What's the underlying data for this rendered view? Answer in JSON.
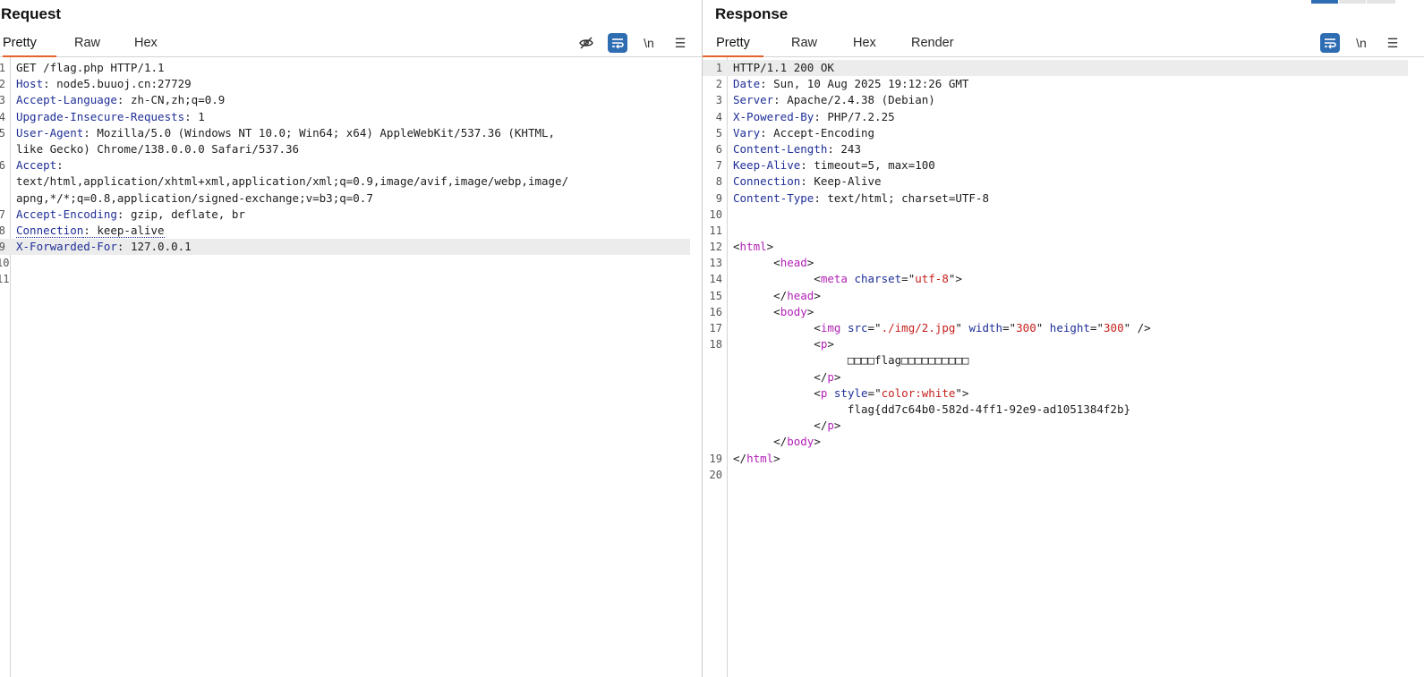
{
  "request": {
    "title": "Request",
    "tabs": [
      "Pretty",
      "Raw",
      "Hex"
    ],
    "active_tab": "Pretty",
    "tools": {
      "hide": "eye-off",
      "wrap": "word-wrap",
      "newline": "\\n",
      "menu": "☰"
    },
    "lines": [
      {
        "n": "1",
        "rows": [
          [
            {
              "s": "GET /flag.php HTTP/1.1"
            }
          ]
        ]
      },
      {
        "n": "2",
        "rows": [
          [
            {
              "s": "Host",
              "c": "k"
            },
            {
              "s": ": node5.buuoj.cn:27729"
            }
          ]
        ]
      },
      {
        "n": "3",
        "rows": [
          [
            {
              "s": "Accept-Language",
              "c": "k"
            },
            {
              "s": ": zh-CN,zh;q=0.9"
            }
          ]
        ]
      },
      {
        "n": "4",
        "rows": [
          [
            {
              "s": "Upgrade-Insecure-Requests",
              "c": "k"
            },
            {
              "s": ": 1"
            }
          ]
        ]
      },
      {
        "n": "5",
        "rows": [
          [
            {
              "s": "User-Agent",
              "c": "k"
            },
            {
              "s": ": Mozilla/5.0 (Windows NT 10.0; Win64; x64) AppleWebKit/537.36 (KHTML,"
            }
          ],
          [
            {
              "s": "like Gecko) Chrome/138.0.0.0 Safari/537.36"
            }
          ]
        ]
      },
      {
        "n": "6",
        "rows": [
          [
            {
              "s": "Accept",
              "c": "k"
            },
            {
              "s": ":"
            }
          ],
          [
            {
              "s": "text/html,application/xhtml+xml,application/xml;q=0.9,image/avif,image/webp,image/"
            }
          ],
          [
            {
              "s": "apng,*/*;q=0.8,application/signed-exchange;v=b3;q=0.7"
            }
          ]
        ]
      },
      {
        "n": "7",
        "rows": [
          [
            {
              "s": "Accept-Encoding",
              "c": "k"
            },
            {
              "s": ": gzip, deflate, br"
            }
          ]
        ]
      },
      {
        "n": "8",
        "rows": [
          [
            {
              "s": "Connection",
              "c": "k dotted"
            },
            {
              "s": ": keep-alive",
              "c": "dotted"
            }
          ]
        ]
      },
      {
        "n": "9",
        "hl": true,
        "rows": [
          [
            {
              "s": "X-Forwarded-For",
              "c": "k"
            },
            {
              "s": ": 127.0.0.1"
            }
          ]
        ]
      },
      {
        "n": "10",
        "rows": [
          []
        ]
      },
      {
        "n": "11",
        "rows": [
          []
        ]
      }
    ]
  },
  "response": {
    "title": "Response",
    "tabs": [
      "Pretty",
      "Raw",
      "Hex",
      "Render"
    ],
    "active_tab": "Pretty",
    "tools": {
      "wrap": "word-wrap",
      "newline": "\\n",
      "menu": "☰"
    },
    "lines": [
      {
        "n": "1",
        "hl": true,
        "rows": [
          [
            {
              "s": "HTTP/1.1 200 OK"
            }
          ]
        ]
      },
      {
        "n": "2",
        "rows": [
          [
            {
              "s": "Date",
              "c": "k"
            },
            {
              "s": ": Sun, 10 Aug 2025 19:12:26 GMT"
            }
          ]
        ]
      },
      {
        "n": "3",
        "rows": [
          [
            {
              "s": "Server",
              "c": "k"
            },
            {
              "s": ": Apache/2.4.38 (Debian)"
            }
          ]
        ]
      },
      {
        "n": "4",
        "rows": [
          [
            {
              "s": "X-Powered-By",
              "c": "k"
            },
            {
              "s": ": PHP/7.2.25"
            }
          ]
        ]
      },
      {
        "n": "5",
        "rows": [
          [
            {
              "s": "Vary",
              "c": "k"
            },
            {
              "s": ": Accept-Encoding"
            }
          ]
        ]
      },
      {
        "n": "6",
        "rows": [
          [
            {
              "s": "Content-Length",
              "c": "k"
            },
            {
              "s": ": 243"
            }
          ]
        ]
      },
      {
        "n": "7",
        "rows": [
          [
            {
              "s": "Keep-Alive",
              "c": "k"
            },
            {
              "s": ": timeout=5, max=100"
            }
          ]
        ]
      },
      {
        "n": "8",
        "rows": [
          [
            {
              "s": "Connection",
              "c": "k"
            },
            {
              "s": ": Keep-Alive"
            }
          ]
        ]
      },
      {
        "n": "9",
        "rows": [
          [
            {
              "s": "Content-Type",
              "c": "k"
            },
            {
              "s": ": text/html; charset=UTF-8"
            }
          ]
        ]
      },
      {
        "n": "10",
        "rows": [
          []
        ]
      },
      {
        "n": "11",
        "rows": [
          []
        ]
      },
      {
        "n": "12",
        "rows": [
          [
            {
              "s": "<"
            },
            {
              "s": "html",
              "c": "t"
            },
            {
              "s": ">"
            }
          ]
        ]
      },
      {
        "n": "13",
        "rows": [
          [
            {
              "s": "      <"
            },
            {
              "s": "head",
              "c": "t"
            },
            {
              "s": ">"
            }
          ]
        ]
      },
      {
        "n": "14",
        "rows": [
          [
            {
              "s": "            <"
            },
            {
              "s": "meta",
              "c": "t"
            },
            {
              "s": " "
            },
            {
              "s": "charset",
              "c": "a"
            },
            {
              "s": "=\""
            },
            {
              "s": "utf-8",
              "c": "v"
            },
            {
              "s": "\">"
            }
          ]
        ]
      },
      {
        "n": "15",
        "rows": [
          [
            {
              "s": "      </"
            },
            {
              "s": "head",
              "c": "t"
            },
            {
              "s": ">"
            }
          ]
        ]
      },
      {
        "n": "16",
        "rows": [
          [
            {
              "s": "      <"
            },
            {
              "s": "body",
              "c": "t"
            },
            {
              "s": ">"
            }
          ]
        ]
      },
      {
        "n": "17",
        "rows": [
          [
            {
              "s": "            <"
            },
            {
              "s": "img",
              "c": "t"
            },
            {
              "s": " "
            },
            {
              "s": "src",
              "c": "a"
            },
            {
              "s": "=\""
            },
            {
              "s": "./img/2.jpg",
              "c": "v"
            },
            {
              "s": "\" "
            },
            {
              "s": "width",
              "c": "a"
            },
            {
              "s": "=\""
            },
            {
              "s": "300",
              "c": "v"
            },
            {
              "s": "\" "
            },
            {
              "s": "height",
              "c": "a"
            },
            {
              "s": "=\""
            },
            {
              "s": "300",
              "c": "v"
            },
            {
              "s": "\" />"
            }
          ]
        ]
      },
      {
        "n": "18",
        "rows": [
          [
            {
              "s": "            <"
            },
            {
              "s": "p",
              "c": "t"
            },
            {
              "s": ">"
            }
          ],
          [
            {
              "s": "                 □□□□flag□□□□□□□□□□"
            }
          ],
          [
            {
              "s": "            </"
            },
            {
              "s": "p",
              "c": "t"
            },
            {
              "s": ">"
            }
          ],
          [
            {
              "s": "            <"
            },
            {
              "s": "p",
              "c": "t"
            },
            {
              "s": " "
            },
            {
              "s": "style",
              "c": "a"
            },
            {
              "s": "=\""
            },
            {
              "s": "color:white",
              "c": "v"
            },
            {
              "s": "\">"
            }
          ],
          [
            {
              "s": "                 flag{dd7c64b0-582d-4ff1-92e9-ad1051384f2b}"
            }
          ],
          [
            {
              "s": "            </"
            },
            {
              "s": "p",
              "c": "t"
            },
            {
              "s": ">"
            }
          ],
          [
            {
              "s": "      </"
            },
            {
              "s": "body",
              "c": "t"
            },
            {
              "s": ">"
            }
          ]
        ]
      },
      {
        "n": "19",
        "rows": [
          [
            {
              "s": "</"
            },
            {
              "s": "html",
              "c": "t"
            },
            {
              "s": ">"
            }
          ]
        ]
      },
      {
        "n": "20",
        "rows": [
          []
        ]
      }
    ]
  },
  "colors": {
    "accent": "#e8622b",
    "toggle_on": "#2f6db3",
    "key": "#1f2f97",
    "tag": "#b222b7",
    "value": "#c5211d"
  }
}
